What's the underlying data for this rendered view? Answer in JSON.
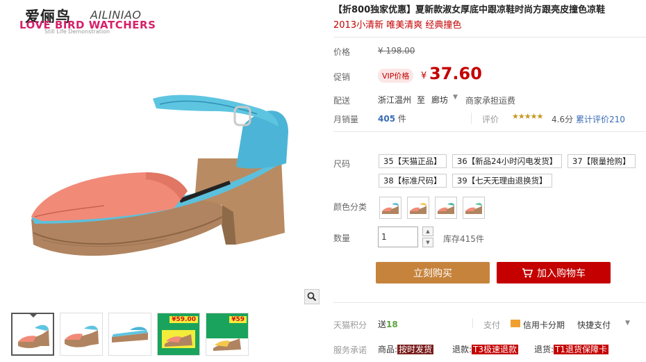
{
  "brand": {
    "name_cn": "爱俪鸟",
    "name_en": "AILINIAO",
    "slogan": "LOVE BIRD WATCHERS",
    "tagline": "Still Life Demonstration"
  },
  "gallery": {
    "zoom_icon": "magnifier-icon",
    "thumbnails": [
      {
        "kind": "photo"
      },
      {
        "kind": "photo"
      },
      {
        "kind": "photo"
      },
      {
        "kind": "promo",
        "price": "¥59.00"
      },
      {
        "kind": "promo",
        "price": "¥59"
      }
    ]
  },
  "product": {
    "title": "【折800独家优惠】夏新款淑女厚底中跟凉鞋时尚方跟亮皮撞色凉鞋",
    "subtitle": "2013小清新 唯美清爽 经典撞色",
    "price_label": "价格",
    "original_price": "¥ 198.00",
    "promo_label": "促销",
    "vip_badge": "VIP价格",
    "currency": "¥",
    "promo_price": "37.60",
    "delivery_label": "配送",
    "ship_from": "浙江温州",
    "ship_to_word": "至",
    "ship_to": "廊坊",
    "ship_fee": "商家承担运费",
    "sales_label": "月销量",
    "sales_count": "405",
    "sales_unit": "件",
    "rating_label": "评价",
    "stars": "★★★★★",
    "rating_value": "4.6分",
    "reviews_link": "累计评价210"
  },
  "options": {
    "size_label": "尺码",
    "sizes": [
      "35【天猫正品】",
      "36【新品24小时闪电发货】",
      "37【限量抢购】",
      "38【标准尺码】",
      "39【七天无理由退换货】"
    ],
    "color_label": "颜色分类",
    "colors": [
      "蓝粉",
      "黄粉",
      "蓝绿",
      "绿粉"
    ],
    "color_hex": [
      "#5bb9da",
      "#f4c64b",
      "#48b39a",
      "#5dbf9a"
    ],
    "qty_label": "数量",
    "qty_value": "1",
    "stock": "库存415件"
  },
  "actions": {
    "buy_now": "立刻购买",
    "add_to_cart": "加入购物车",
    "buy_color": "#c6833c",
    "cart_color": "#c40000"
  },
  "footer": {
    "points_label": "天猫积分",
    "points_prefix": "送",
    "points_value": "18",
    "pay_label": "支付",
    "card_installment": "信用卡分期",
    "quick_pay": "快捷支付",
    "service_label": "服务承诺",
    "services": [
      {
        "prefix": "商品:",
        "tag": "按时发货"
      },
      {
        "prefix": "退款:",
        "tag": "T3极速退款"
      },
      {
        "prefix": "退货:",
        "tag": "T1退货保障卡"
      }
    ]
  }
}
